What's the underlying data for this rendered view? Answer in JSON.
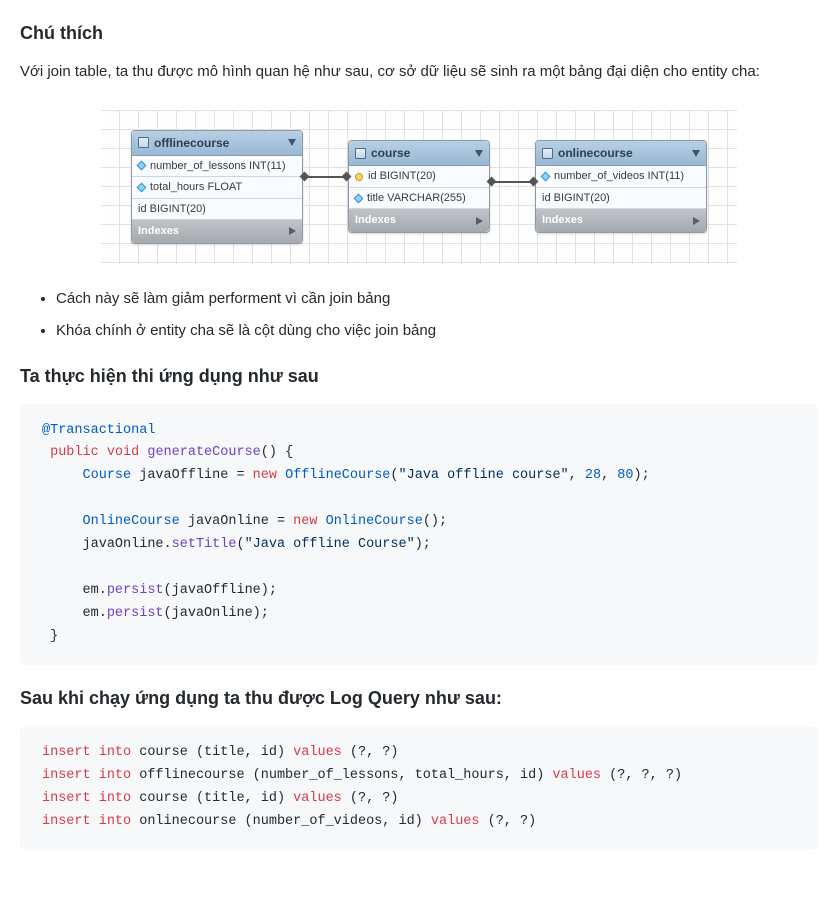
{
  "h1": "Chú thích",
  "intro": "Với join table, ta thu được mô hình quan hệ như sau, cơ sở dữ liệu sẽ sinh ra một bảng đại diện cho entity cha:",
  "tables": {
    "offline": {
      "title": "offlinecourse",
      "rows": [
        "number_of_lessons INT(11)",
        "total_hours FLOAT",
        "id BIGINT(20)"
      ],
      "footer": "Indexes"
    },
    "course": {
      "title": "course",
      "rows": [
        "id BIGINT(20)",
        "title VARCHAR(255)"
      ],
      "footer": "Indexes"
    },
    "online": {
      "title": "onlinecourse",
      "rows": [
        "number_of_videos INT(11)",
        "id BIGINT(20)"
      ],
      "footer": "Indexes"
    }
  },
  "bullets": [
    "Cách này sẽ làm giảm performent vì cần join bảng",
    "Khóa chính ở entity cha sẽ là cột dùng cho việc join bảng"
  ],
  "h2": "Ta thực hiện thi ứng dụng như sau",
  "code1": {
    "anno": "@Transactional",
    "kw_public": "public",
    "kw_void": "void",
    "fn_gen": "generateCourse",
    "type_course": "Course",
    "var_off": "javaOffline",
    "kw_new": "new",
    "type_offc": "OfflineCourse",
    "str1": "\"Java offline course\"",
    "n1": "28",
    "n2": "80",
    "type_oc": "OnlineCourse",
    "var_on": "javaOnline",
    "type_oc2": "OnlineCourse",
    "m_set": "setTitle",
    "str2": "\"Java offline Course\"",
    "em": "em",
    "m_persist": "persist"
  },
  "h3": "Sau khi chạy ứng dụng ta thu được Log Query như sau:",
  "code2": {
    "insert": "insert",
    "into": "into",
    "values": "values",
    "l1a": "course (title, id)",
    "l1b": "(?, ?)",
    "l2a": "offlinecourse (number_of_lessons, total_hours, id)",
    "l2b": "(?, ?, ?)",
    "l3a": "course (title, id)",
    "l3b": "(?, ?)",
    "l4a": "onlinecourse (number_of_videos, id)",
    "l4b": "(?, ?)"
  }
}
